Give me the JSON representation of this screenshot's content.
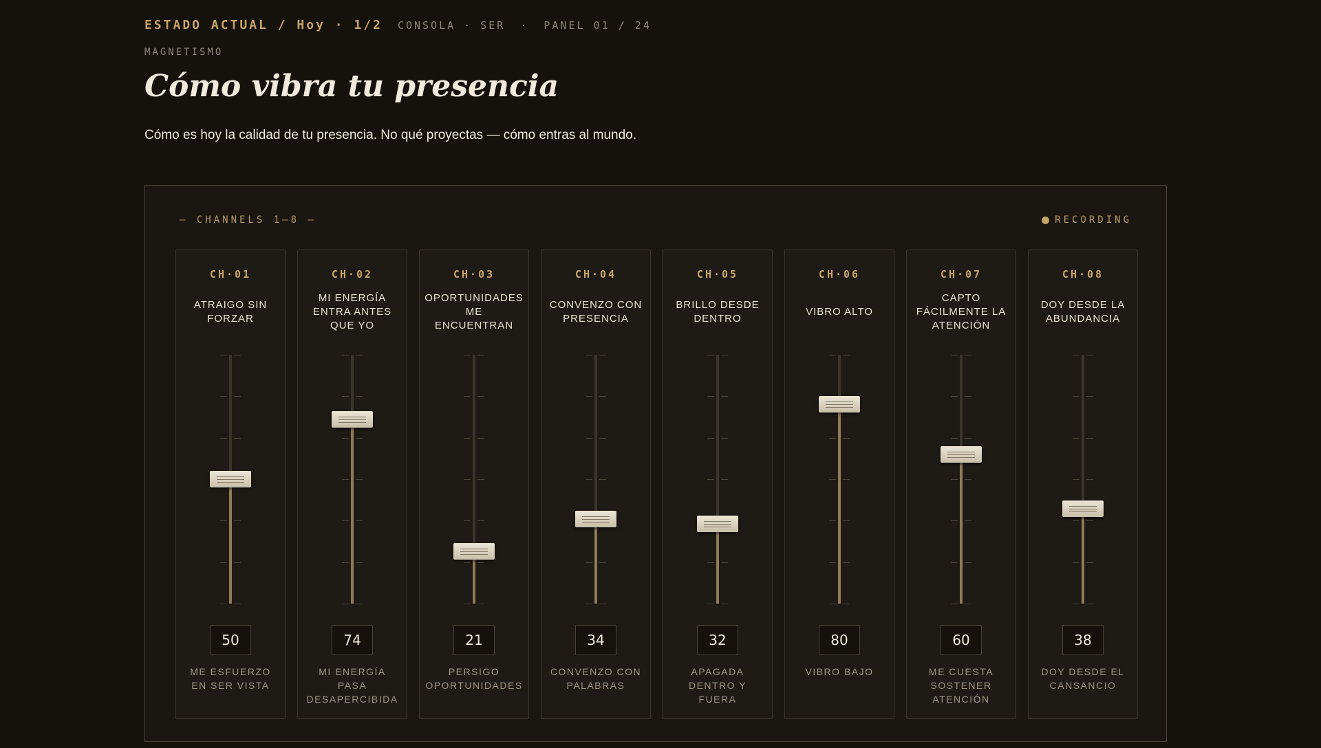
{
  "header": {
    "state": "ESTADO ACTUAL / Hoy · 1/2",
    "console": "CONSOLA · SER",
    "separator": "·",
    "panel": "PANEL 01 / 24",
    "eyebrow": "MAGNETISMO",
    "title": "Cómo vibra tu presencia",
    "subtitle": "Cómo es hoy la calidad de tu presencia. No qué proyectas — cómo entras al mundo."
  },
  "panel": {
    "heading": "— CHANNELS 1–8 —",
    "recording": "RECORDING"
  },
  "channels": [
    {
      "id": "CH·01",
      "label": "ATRAIGO SIN FORZAR",
      "low": "ME ESFUERZO EN SER VISTA",
      "value": 50
    },
    {
      "id": "CH·02",
      "label": "MI ENERGÍA ENTRA ANTES QUE YO",
      "low": "MI ENERGÍA PASA DESAPERCIBIDA",
      "value": 74
    },
    {
      "id": "CH·03",
      "label": "OPORTUNIDADES ME ENCUENTRAN",
      "low": "PERSIGO OPORTUNIDADES",
      "value": 21
    },
    {
      "id": "CH·04",
      "label": "CONVENZO CON PRESENCIA",
      "low": "CONVENZO CON PALABRAS",
      "value": 34
    },
    {
      "id": "CH·05",
      "label": "BRILLO DESDE DENTRO",
      "low": "APAGADA DENTRO Y FUERA",
      "value": 32
    },
    {
      "id": "CH·06",
      "label": "VIBRO ALTO",
      "low": "VIBRO BAJO",
      "value": 80
    },
    {
      "id": "CH·07",
      "label": "CAPTO FÁCILMENTE LA ATENCIÓN",
      "low": "ME CUESTA SOSTENER ATENCIÓN",
      "value": 60
    },
    {
      "id": "CH·08",
      "label": "DOY DESDE LA ABUNDANCIA",
      "low": "DOY DESDE EL CANSANCIO",
      "value": 38
    }
  ],
  "colors": {
    "accent": "#c5a46a",
    "background": "#15110d",
    "text": "#f1ebdf"
  }
}
